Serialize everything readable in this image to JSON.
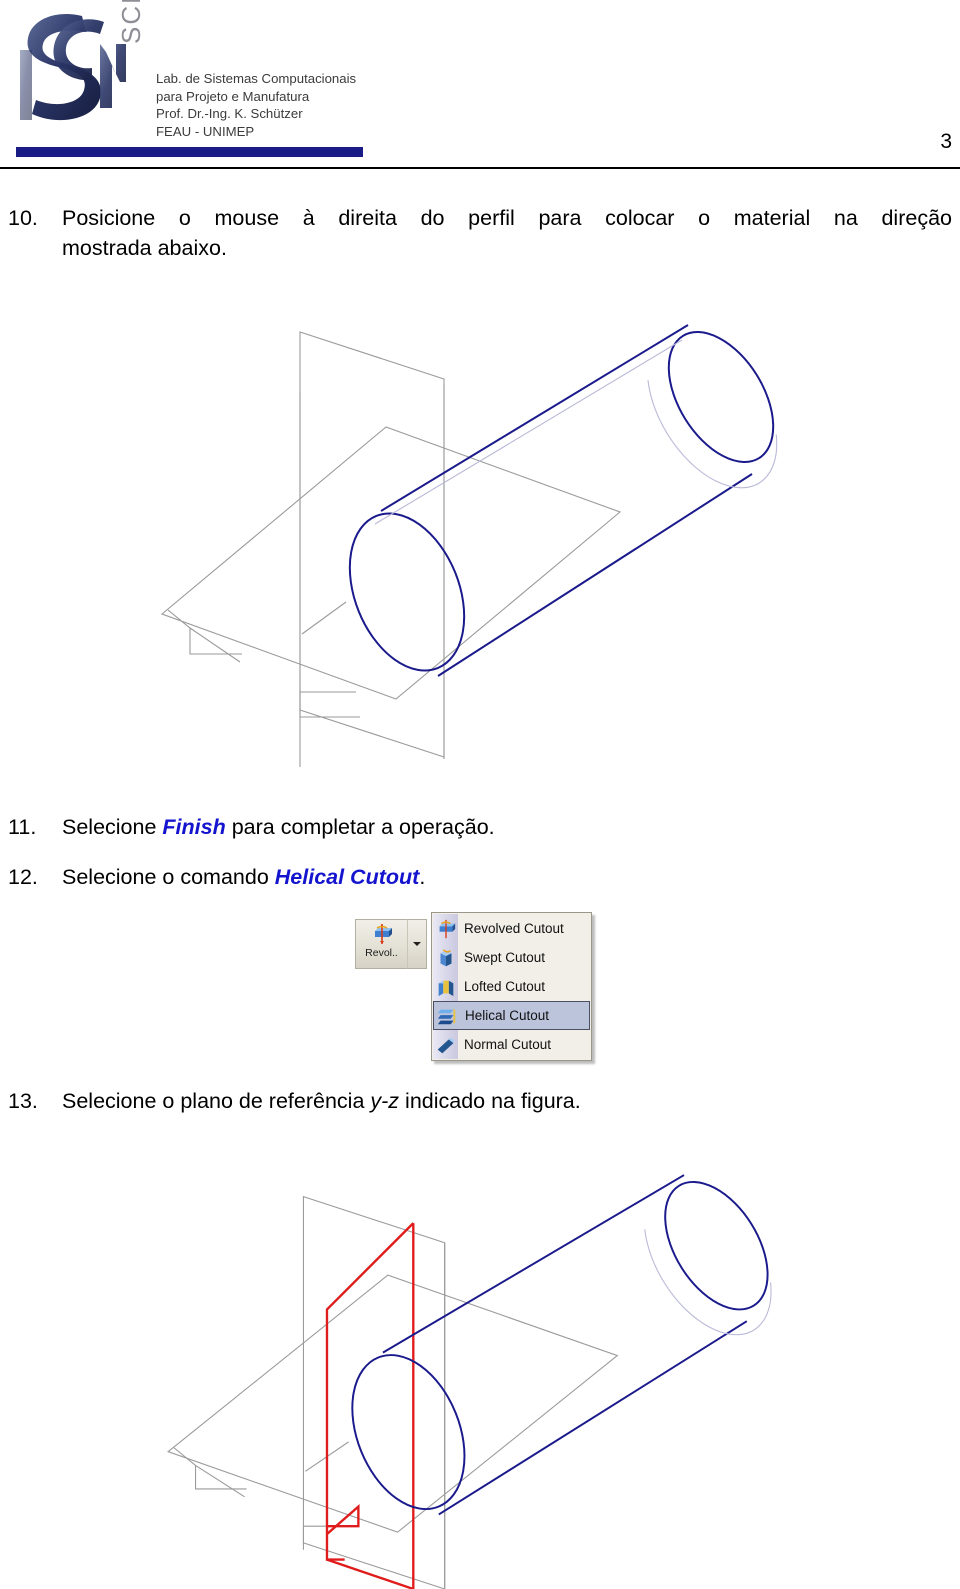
{
  "header": {
    "logo_monogram": "SCM",
    "logo_vertical_text": "SCPM",
    "org_lines": [
      "Lab. de Sistemas Computacionais",
      "para Projeto e Manufatura",
      "Prof. Dr.-Ing. K. Schützer",
      "FEAU - UNIMEP"
    ],
    "page_number": "3",
    "bar_color": "#1b1b86"
  },
  "steps": [
    {
      "number": "10.",
      "line1": "Posicione o mouse à direita do perfil para colocar o material na direção",
      "line2": "mostrada abaixo."
    },
    {
      "number": "11.",
      "text_before": "Selecione ",
      "keyword": "Finish",
      "text_after": " para completar a operação."
    },
    {
      "number": "12.",
      "text_before": "Selecione o comando ",
      "keyword": "Helical Cutout",
      "text_after": "."
    },
    {
      "number": "13.",
      "text_before": "Selecione o plano de referência ",
      "emphasis": "y-z",
      "text_after": " indicado na figura."
    }
  ],
  "toolbar": {
    "button_label": "Revol..",
    "button_icon": "revolved-cutout-icon",
    "dropdown_arrow_icon": "chevron-down-icon"
  },
  "dropdown_menu": {
    "items": [
      {
        "label": "Revolved Cutout",
        "icon": "revolved-cutout-icon",
        "selected": false
      },
      {
        "label": "Swept Cutout",
        "icon": "swept-cutout-icon",
        "selected": false
      },
      {
        "label": "Lofted Cutout",
        "icon": "lofted-cutout-icon",
        "selected": false
      },
      {
        "label": "Helical Cutout",
        "icon": "helical-cutout-icon",
        "selected": true
      },
      {
        "label": "Normal Cutout",
        "icon": "normal-cutout-icon",
        "selected": false
      }
    ],
    "selected_item": "Helical Cutout",
    "highlight_color": "#bcc4dc"
  },
  "figures": [
    {
      "name": "isometric-cylinder-with-reference-planes",
      "caption": "",
      "model_color": "#1a1a8c",
      "plane_color": "#9a9a9a",
      "description": "Cylinder shown in isometric view intersecting two gray reference planes"
    },
    {
      "name": "isometric-cylinder-with-selected-yz-plane",
      "caption": "",
      "model_color": "#1a1a8c",
      "plane_color": "#9a9a9a",
      "highlight_color": "#e01b1b",
      "description": "Same isometric cylinder with the y-z reference plane outlined in red to show it is selected"
    }
  ]
}
